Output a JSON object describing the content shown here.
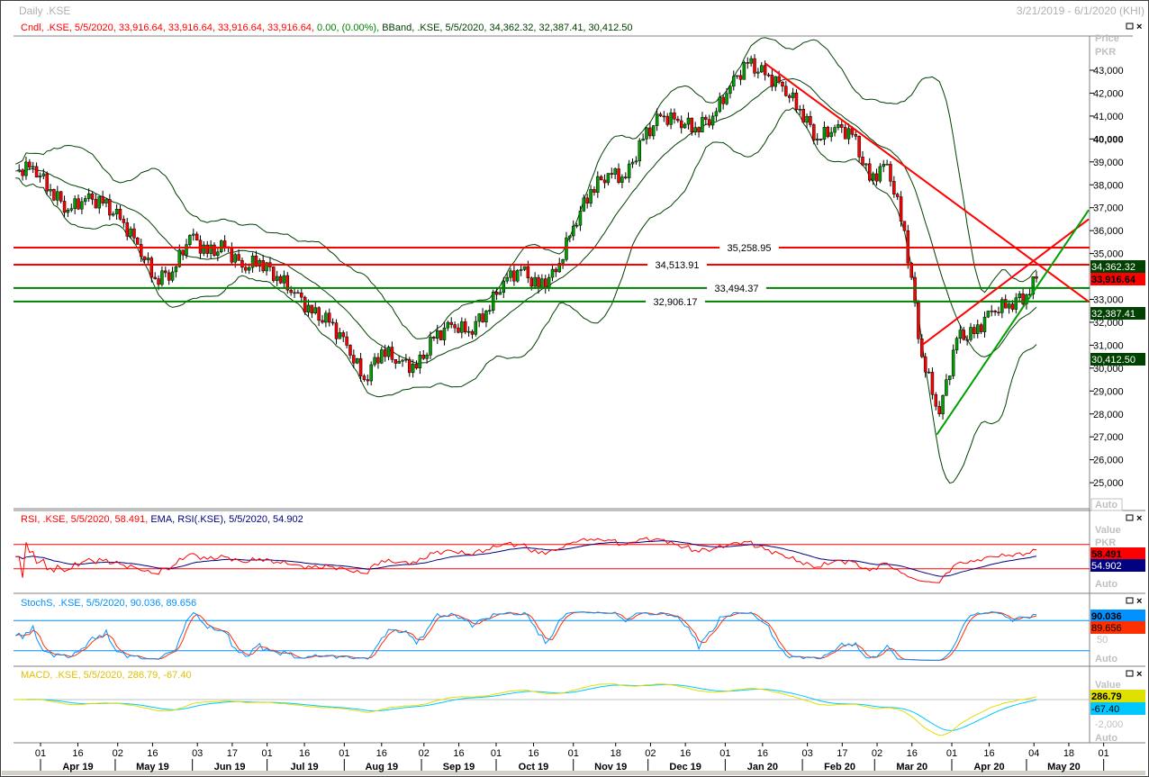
{
  "window": {
    "title": "Daily .KSE",
    "range": "3/21/2019 - 6/1/2020 (KHI)"
  },
  "legend": {
    "candle": "Cndl, .KSE, 5/5/2020, 33,916.64, 33,916.64, 33,916.64, 33,916.64,",
    "change": "0.00, (0.00%),",
    "bband": "BBand, .KSE, 5/5/2020, 34,362.32, 32,387.41, 30,412.50",
    "rsi_a": "RSI, .KSE, 5/5/2020, 58.491,",
    "rsi_b": "EMA, RSI(.KSE), 5/5/2020, 54.902",
    "stoch": "StochS, .KSE, 5/5/2020, 90.036, 89.656",
    "macd": "MACD, .KSE, 5/5/2020, 286.79, -67.40"
  },
  "axis": {
    "price_title": "Price",
    "price_unit": "PKR",
    "value_title": "Value",
    "value_unit": "PKR",
    "value_title_short": "Value",
    "auto": "Auto",
    "stoch_mid": "50",
    "macd_tick": "-2,000",
    "price_ticks": [
      "43,000",
      "42,000",
      "41,000",
      "40,000",
      "39,000",
      "38,000",
      "37,000",
      "36,000",
      "35,000",
      "33,000",
      "32,000",
      "31,000",
      "30,000",
      "29,000",
      "28,000",
      "27,000",
      "26,000",
      "25,000"
    ],
    "day_ticks": [
      [
        "2019-04-01",
        "01"
      ],
      [
        "2019-04-16",
        "16"
      ],
      [
        "2019-05-02",
        "02"
      ],
      [
        "2019-05-16",
        "16"
      ],
      [
        "2019-06-03",
        "03"
      ],
      [
        "2019-06-17",
        "17"
      ],
      [
        "2019-07-01",
        "01"
      ],
      [
        "2019-07-16",
        "16"
      ],
      [
        "2019-08-01",
        "01"
      ],
      [
        "2019-08-16",
        "16"
      ],
      [
        "2019-09-02",
        "02"
      ],
      [
        "2019-09-16",
        "16"
      ],
      [
        "2019-10-01",
        "01"
      ],
      [
        "2019-10-16",
        "16"
      ],
      [
        "2019-11-01",
        "01"
      ],
      [
        "2019-11-18",
        "18"
      ],
      [
        "2019-12-02",
        "02"
      ],
      [
        "2019-12-16",
        "16"
      ],
      [
        "2020-01-01",
        "01"
      ],
      [
        "2020-01-16",
        "16"
      ],
      [
        "2020-02-03",
        "03"
      ],
      [
        "2020-02-17",
        "17"
      ],
      [
        "2020-03-02",
        "02"
      ],
      [
        "2020-03-16",
        "16"
      ],
      [
        "2020-04-01",
        "01"
      ],
      [
        "2020-04-16",
        "16"
      ],
      [
        "2020-05-04",
        "04"
      ],
      [
        "2020-05-18",
        "18"
      ],
      [
        "2020-06-01",
        "01"
      ]
    ],
    "month_labels": [
      [
        "2019-04-16",
        "Apr 19"
      ],
      [
        "2019-05-16",
        "May 19"
      ],
      [
        "2019-06-16",
        "Jun 19"
      ],
      [
        "2019-07-16",
        "Jul 19"
      ],
      [
        "2019-08-16",
        "Aug 19"
      ],
      [
        "2019-09-16",
        "Sep 19"
      ],
      [
        "2019-10-16",
        "Oct 19"
      ],
      [
        "2019-11-16",
        "Nov 19"
      ],
      [
        "2019-12-16",
        "Dec 19"
      ],
      [
        "2020-01-16",
        "Jan 20"
      ],
      [
        "2020-02-16",
        "Feb 20"
      ],
      [
        "2020-03-16",
        "Mar 20"
      ],
      [
        "2020-04-16",
        "Apr 20"
      ],
      [
        "2020-05-16",
        "May 20"
      ]
    ]
  },
  "colors": {
    "up": "#00a000",
    "down": "#ff0000",
    "band": "#004000",
    "rsi": "#ff0000",
    "rsi_ema": "#000080",
    "stoch_k": "#0090ff",
    "stoch_d": "#ff3000",
    "macd": "#e0e000",
    "signal": "#00c8ff"
  },
  "chart_data": [
    {
      "type": "candlestick",
      "title": "Daily .KSE",
      "ylabel": "Price PKR",
      "ylim": [
        24500,
        44000
      ],
      "dates": [
        "2019-03-22",
        "2019-03-29",
        "2019-04-05",
        "2019-04-12",
        "2019-04-19",
        "2019-04-26",
        "2019-05-03",
        "2019-05-10",
        "2019-05-17",
        "2019-05-24",
        "2019-05-31",
        "2019-06-07",
        "2019-06-14",
        "2019-06-21",
        "2019-06-28",
        "2019-07-05",
        "2019-07-12",
        "2019-07-19",
        "2019-07-26",
        "2019-08-02",
        "2019-08-09",
        "2019-08-16",
        "2019-08-23",
        "2019-08-30",
        "2019-09-06",
        "2019-09-13",
        "2019-09-20",
        "2019-09-27",
        "2019-10-04",
        "2019-10-11",
        "2019-10-18",
        "2019-10-25",
        "2019-11-01",
        "2019-11-08",
        "2019-11-15",
        "2019-11-22",
        "2019-11-29",
        "2019-12-06",
        "2019-12-13",
        "2019-12-20",
        "2019-12-27",
        "2020-01-03",
        "2020-01-10",
        "2020-01-17",
        "2020-01-24",
        "2020-01-31",
        "2020-02-07",
        "2020-02-14",
        "2020-02-21",
        "2020-02-28",
        "2020-03-06",
        "2020-03-13",
        "2020-03-20",
        "2020-03-27",
        "2020-04-03",
        "2020-04-10",
        "2020-04-17",
        "2020-04-24",
        "2020-05-01",
        "2020-05-05"
      ],
      "close": [
        38600,
        38800,
        37800,
        36900,
        37400,
        37200,
        36500,
        35400,
        33900,
        34200,
        35800,
        35000,
        35300,
        34400,
        34700,
        34000,
        33300,
        32400,
        32000,
        31000,
        29500,
        30800,
        30300,
        30000,
        31300,
        31900,
        31600,
        32500,
        33800,
        34300,
        33500,
        34200,
        36200,
        37800,
        38500,
        38300,
        40000,
        41000,
        40800,
        40500,
        41000,
        42300,
        43300,
        42800,
        42300,
        41300,
        40000,
        40500,
        40200,
        38200,
        38900,
        36000,
        30500,
        28000,
        31300,
        31500,
        32500,
        32800,
        33200,
        33916.64
      ],
      "last": {
        "close": "33,916.64",
        "bb_upper": "34,362.32",
        "bb_mid": "32,387.41",
        "bb_lower": "30,412.50"
      },
      "hlines": [
        {
          "value": 35258.95,
          "label": "35,258.95",
          "color": "#ff0000"
        },
        {
          "value": 34513.91,
          "label": "34,513.91",
          "color": "#ff0000"
        },
        {
          "value": 33494.37,
          "label": "33,494.37",
          "color": "#008000"
        },
        {
          "value": 32906.17,
          "label": "32,906.17",
          "color": "#008000"
        }
      ],
      "trendlines": [
        {
          "from": [
            "2020-01-17",
            43300
          ],
          "to": [
            "2020-05-26",
            32900
          ],
          "color": "#ff0000"
        },
        {
          "from": [
            "2020-03-20",
            31000
          ],
          "to": [
            "2020-05-26",
            36500
          ],
          "color": "#ff0000"
        },
        {
          "from": [
            "2020-03-26",
            27100
          ],
          "to": [
            "2020-05-26",
            36900
          ],
          "color": "#00a000"
        }
      ]
    },
    {
      "type": "line",
      "name": "RSI",
      "levels": [
        70,
        30
      ],
      "last": [
        "58.491",
        "54.902"
      ]
    },
    {
      "type": "line",
      "name": "StochS",
      "levels": [
        80,
        20
      ],
      "last": [
        "90.036",
        "89.656"
      ]
    },
    {
      "type": "line",
      "name": "MACD",
      "levels": [
        0
      ],
      "last": [
        "286.79",
        "-67.40"
      ]
    }
  ]
}
